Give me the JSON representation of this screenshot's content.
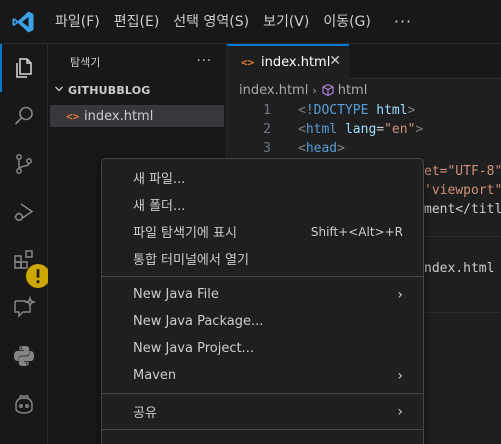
{
  "colors": {
    "accent": "#0078d4",
    "html_icon": "#e37933",
    "warning": "#cca700",
    "background": "#1f1f1f"
  },
  "menubar": {
    "items": [
      "파일(F)",
      "편집(E)",
      "선택 영역(S)",
      "보기(V)",
      "이동(G)"
    ],
    "more": "···"
  },
  "activitybar": {
    "icons": [
      "explorer-icon",
      "search-icon",
      "source-control-icon",
      "run-debug-icon",
      "extensions-icon",
      "chat-icon",
      "python-icon",
      "copilot-icon"
    ]
  },
  "sidebar": {
    "title": "탐색기",
    "more": "···",
    "folder": "GITHUBBLOG",
    "file_icon": "<>",
    "file": "index.html"
  },
  "editor": {
    "tab": {
      "icon": "<>",
      "label": "index.html",
      "close": "✕"
    },
    "breadcrumb": {
      "file": "index.html",
      "sep": "›",
      "symbol": "html"
    },
    "lines": [
      {
        "n": "1",
        "parts": [
          [
            "c-tag",
            "<"
          ],
          [
            "c-name",
            "!DOCTYPE"
          ],
          [
            "c-txt",
            " "
          ],
          [
            "c-attr",
            "html"
          ],
          [
            "c-tag",
            ">"
          ]
        ]
      },
      {
        "n": "2",
        "parts": [
          [
            "c-tag",
            "<"
          ],
          [
            "c-name",
            "html"
          ],
          [
            "c-txt",
            " "
          ],
          [
            "c-attr",
            "lang"
          ],
          [
            "c-txt",
            "="
          ],
          [
            "c-str",
            "\"en\""
          ],
          [
            "c-tag",
            ">"
          ]
        ]
      },
      {
        "n": "3",
        "parts": [
          [
            "c-tag",
            "<"
          ],
          [
            "c-name",
            "head"
          ],
          [
            "c-tag",
            ">"
          ]
        ]
      }
    ],
    "peek": [
      {
        "text": "et=\"UTF-8\"",
        "cls": "c-str"
      },
      {
        "text": "'viewport\"",
        "cls": "c-str"
      },
      {
        "text": "ment</title",
        "cls": "c-txt"
      },
      {
        "text": "ndex.html D",
        "cls": "c-txt"
      }
    ]
  },
  "context_menu": {
    "groups": [
      [
        {
          "label": "새 파일...",
          "key": ""
        },
        {
          "label": "새 폴더...",
          "key": ""
        },
        {
          "label": "파일 탐색기에 표시",
          "key": "Shift+<Alt>+R"
        },
        {
          "label": "통합 터미널에서 열기",
          "key": ""
        }
      ],
      [
        {
          "label": "New Java File",
          "submenu": true
        },
        {
          "label": "New Java Package...",
          "key": ""
        },
        {
          "label": "New Java Project...",
          "key": ""
        },
        {
          "label": "Maven",
          "submenu": true
        }
      ],
      [
        {
          "label": "공유",
          "submenu": true
        }
      ]
    ],
    "submenu_arrow": "›"
  }
}
